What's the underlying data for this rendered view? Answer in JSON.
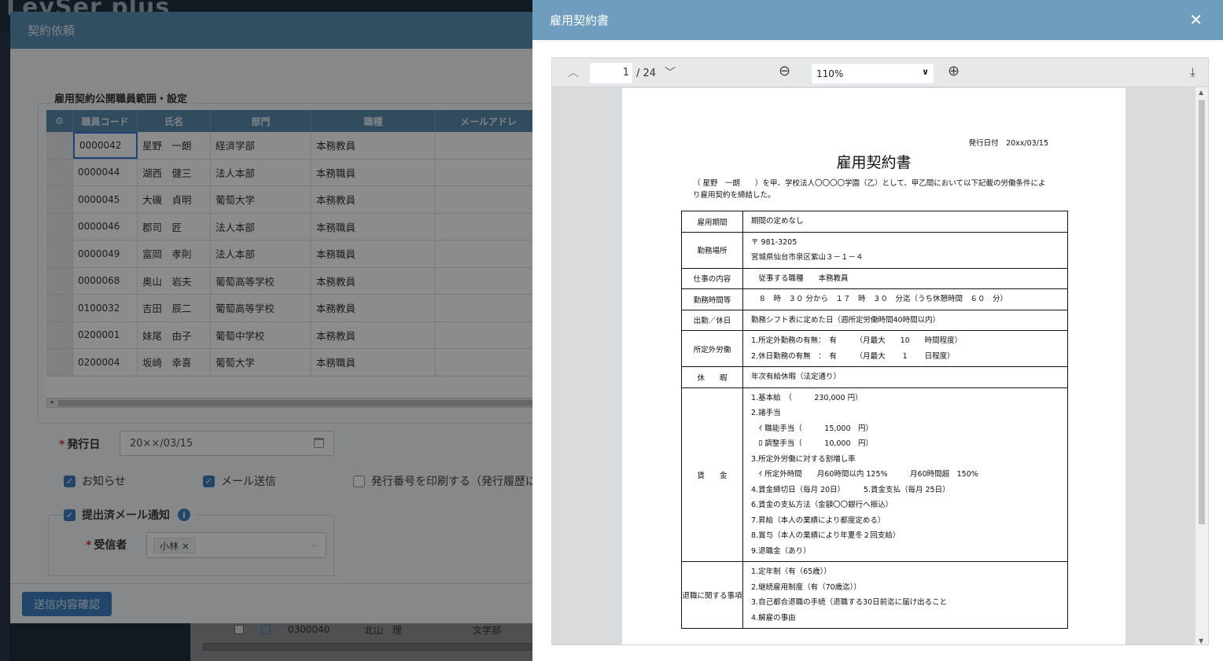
{
  "bg": {
    "logo": "LeySer plus",
    "row": {
      "code": "0300040",
      "name": "北山　理",
      "dept": "文学部"
    }
  },
  "dialog": {
    "title": "契約依頼",
    "section_title": "雇用契約公開職員範囲・設定",
    "columns": [
      "職員コード",
      "氏名",
      "部門",
      "職種",
      "メールアドレ"
    ],
    "rows": [
      {
        "code": "0000042",
        "name": "星野　一朗",
        "dept": "経済学部",
        "job": "本務教員"
      },
      {
        "code": "0000044",
        "name": "湖西　健三",
        "dept": "法人本部",
        "job": "本務職員"
      },
      {
        "code": "0000045",
        "name": "大磯　貞明",
        "dept": "葡萄大学",
        "job": "本務教員"
      },
      {
        "code": "0000046",
        "name": "郡司　匠",
        "dept": "法人本部",
        "job": "本務職員"
      },
      {
        "code": "0000049",
        "name": "富岡　孝則",
        "dept": "法人本部",
        "job": "本務職員"
      },
      {
        "code": "0000068",
        "name": "奥山　岩夫",
        "dept": "葡萄高等学校",
        "job": "本務教員"
      },
      {
        "code": "0100032",
        "name": "吉田　辰二",
        "dept": "葡萄高等学校",
        "job": "本務教員"
      },
      {
        "code": "0200001",
        "name": "妹尾　由子",
        "dept": "葡萄中学校",
        "job": "本務教員"
      },
      {
        "code": "0200004",
        "name": "坂崎　幸喜",
        "dept": "葡萄大学",
        "job": "本務職員"
      }
    ],
    "issue_date_label": "発行日",
    "issue_date_value": "20××/03/15",
    "chk_notice": "お知らせ",
    "chk_mail": "メール送信",
    "chk_print_no": "発行番号を印刷する（発行履歴に記",
    "chk_submitted": "提出済メール通知",
    "recipient_label": "受信者",
    "recipient_tag": "小林 ×",
    "submit": "送信内容確認"
  },
  "panel": {
    "title": "雇用契約書",
    "close": "✕",
    "page_current": "1",
    "page_total": "/ 24",
    "zoom": "110%"
  },
  "doc": {
    "issue_date": "発行日付　20xx/03/15",
    "title": "雇用契約書",
    "preamble": "（ 星野　一朗　　）を甲、学校法人〇〇〇〇学園（乙）として、甲乙間において以下記載の労働条件により雇用契約を締結した。",
    "rows": [
      {
        "h": "雇用期間",
        "v": [
          "期間の定めなし"
        ]
      },
      {
        "h": "勤務場所",
        "v": [
          "〒 981-3205",
          "宮城県仙台市泉区紫山３－１－４"
        ]
      },
      {
        "h": "仕事の内容",
        "v": [
          "　従事する職種　　本務教員"
        ]
      },
      {
        "h": "勤務時間等",
        "v": [
          "　８　時　３０ 分から　１７　時　３０　分迄（うち休憩時間　６０　分）"
        ]
      },
      {
        "h": "出勤／休日",
        "v": [
          "勤務シフト表に定めた日（週所定労働時間40時間以内）"
        ]
      },
      {
        "h": "所定外労働",
        "v": [
          "1.所定外勤務の有無：　有　　　（月最大　　10　　時間程度）",
          "2.休日勤務の有無　：　有　　　（月最大　　 1 　　日程度）"
        ]
      },
      {
        "h": "休　　暇",
        "v": [
          "年次有給休暇（法定通り）"
        ]
      },
      {
        "h": "賃　　金",
        "v": [
          "1.基本給　（　　　230,000 円）",
          "2.諸手当",
          "　ｲ 職能手当（　　　15,000　円）",
          "　ﾛ 調整手当（　　　10,000　円）",
          "3.所定外労働に対する割増し率",
          "　ｲ 所定外時間　　月60時間以内 125%　　　月60時間超　150%",
          "4.賃金締切日（毎月 20日）　　　5.賃金支払（毎月 25日）",
          "6.賃金の支払方法（金額〇〇銀行へ振込）",
          "7.昇給（本人の業績により都度定める）",
          "8.賞与（本人の業績により年夏冬２回支給）",
          "9.退職金（あり）"
        ]
      },
      {
        "h": "退職に関する事項",
        "v": [
          "1.定年制（有（65歳））",
          "2.継続雇用制度（有（70歳迄））",
          "3.自己都合退職の手続（退職する30日前迄に届け出ること",
          "4.解雇の事由"
        ]
      }
    ]
  }
}
